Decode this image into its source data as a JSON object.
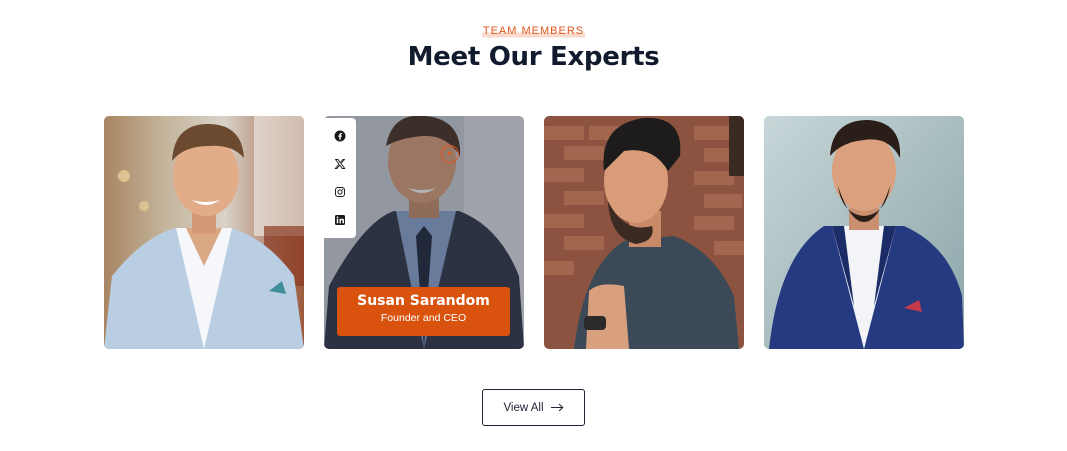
{
  "section": {
    "eyebrow": "TEAM MEMBERS",
    "heading": "Meet Our Experts"
  },
  "members": [
    {
      "photo_alt": "Smiling man in light blue blazer"
    },
    {
      "name": "Susan Sarandom",
      "role": "Founder and CEO",
      "social": [
        "facebook-icon",
        "x-icon",
        "instagram-icon",
        "linkedin-icon"
      ]
    },
    {
      "photo_alt": "Man in dark denim shirt against brick wall"
    },
    {
      "photo_alt": "Man in navy suit"
    }
  ],
  "button": {
    "label": "View All",
    "icon": "arrow-right-icon"
  },
  "colors": {
    "accent": "#e3561c",
    "heading": "#121a2e",
    "name_box": "#d9530f"
  }
}
